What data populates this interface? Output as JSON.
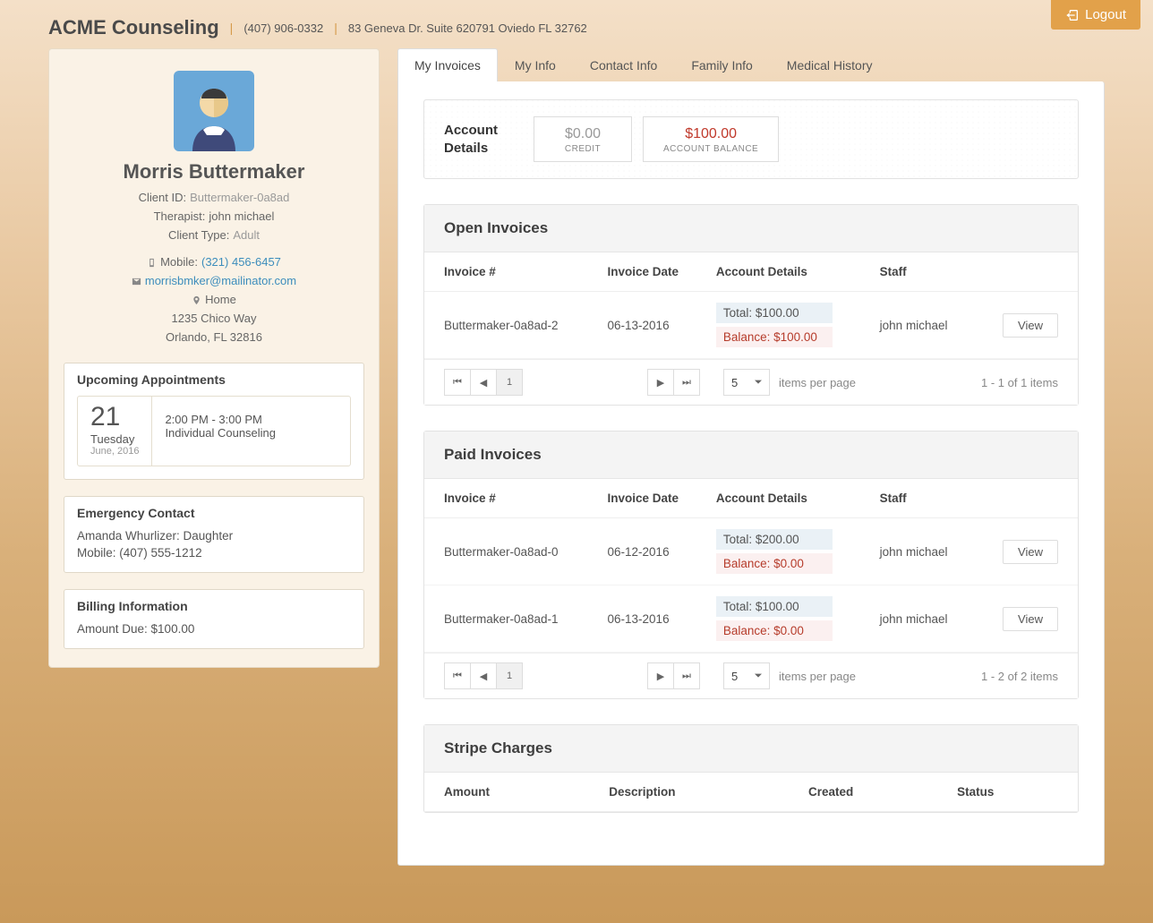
{
  "header": {
    "brand": "ACME Counseling",
    "phone": "(407) 906-0332",
    "address": "83 Geneva Dr. Suite 620791 Oviedo FL 32762",
    "logout": "Logout"
  },
  "client": {
    "name": "Morris Buttermaker",
    "id_label": "Client ID:",
    "id": "Buttermaker-0a8ad",
    "therapist_label": "Therapist:",
    "therapist": "john michael",
    "type_label": "Client Type:",
    "type": "Adult",
    "mobile_label": "Mobile:",
    "mobile": "(321) 456-6457",
    "email": "morrisbmker@mailinator.com",
    "home_label": "Home",
    "street": "1235 Chico Way",
    "city": "Orlando, FL 32816"
  },
  "upcoming": {
    "title": "Upcoming Appointments",
    "day_num": "21",
    "day_name": "Tuesday",
    "month": "June, 2016",
    "time": "2:00 PM - 3:00 PM",
    "type": "Individual Counseling"
  },
  "emergency": {
    "title": "Emergency Contact",
    "line1": "Amanda Whurlizer: Daughter",
    "line2": "Mobile: (407) 555-1212"
  },
  "billing": {
    "title": "Billing Information",
    "line": "Amount Due: $100.00"
  },
  "tabs": {
    "invoices": "My Invoices",
    "info": "My Info",
    "contact": "Contact Info",
    "family": "Family Info",
    "medical": "Medical History"
  },
  "account": {
    "title1": "Account",
    "title2": "Details",
    "credit_val": "$0.00",
    "credit_lbl": "CREDIT",
    "balance_val": "$100.00",
    "balance_lbl": "ACCOUNT BALANCE"
  },
  "open": {
    "title": "Open Invoices",
    "cols": {
      "invoice": "Invoice #",
      "date": "Invoice Date",
      "acct": "Account Details",
      "staff": "Staff"
    },
    "row": {
      "id": "Buttermaker-0a8ad-2",
      "date": "06-13-2016",
      "total": "Total: $100.00",
      "balance": "Balance: $100.00",
      "staff": "john michael",
      "view": "View"
    },
    "pager": {
      "page": "1",
      "per": "5",
      "ipp": "items per page",
      "range": "1 - 1 of 1 items"
    }
  },
  "paid": {
    "title": "Paid Invoices",
    "cols": {
      "invoice": "Invoice #",
      "date": "Invoice Date",
      "acct": "Account Details",
      "staff": "Staff"
    },
    "rows": [
      {
        "id": "Buttermaker-0a8ad-0",
        "date": "06-12-2016",
        "total": "Total: $200.00",
        "balance": "Balance: $0.00",
        "staff": "john michael",
        "view": "View"
      },
      {
        "id": "Buttermaker-0a8ad-1",
        "date": "06-13-2016",
        "total": "Total: $100.00",
        "balance": "Balance: $0.00",
        "staff": "john michael",
        "view": "View"
      }
    ],
    "pager": {
      "page": "1",
      "per": "5",
      "ipp": "items per page",
      "range": "1 - 2 of 2 items"
    }
  },
  "stripe": {
    "title": "Stripe Charges",
    "cols": {
      "amount": "Amount",
      "desc": "Description",
      "created": "Created",
      "status": "Status"
    }
  }
}
